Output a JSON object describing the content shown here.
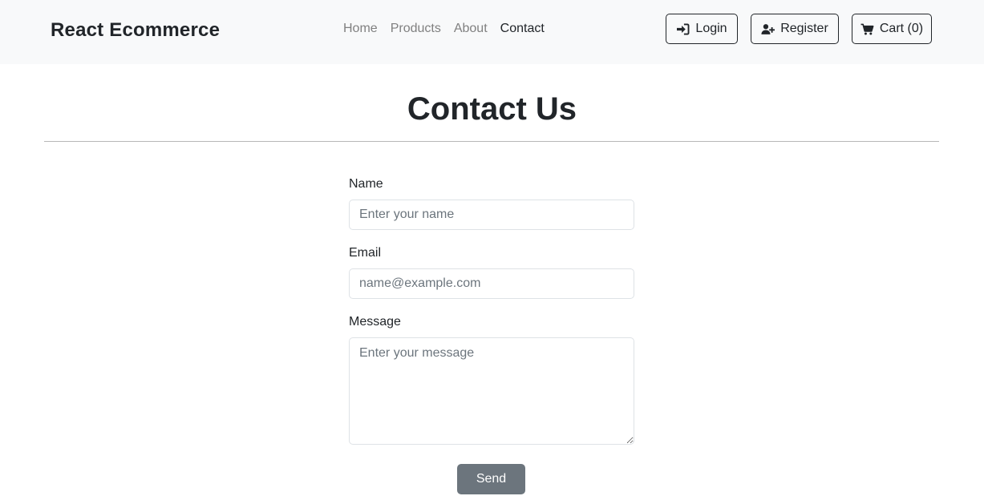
{
  "navbar": {
    "brand": "React Ecommerce",
    "links": [
      {
        "label": "Home"
      },
      {
        "label": "Products"
      },
      {
        "label": "About"
      },
      {
        "label": "Contact"
      }
    ],
    "login_label": "Login",
    "register_label": "Register",
    "cart_label": "Cart (0)",
    "login_icon": "sign-in-icon",
    "register_icon": "user-plus-icon",
    "cart_icon": "shopping-cart-icon"
  },
  "main": {
    "title": "Contact Us",
    "form": {
      "name_label": "Name",
      "name_placeholder": "Enter your name",
      "email_label": "Email",
      "email_placeholder": "name@example.com",
      "message_label": "Message",
      "message_placeholder": "Enter your message",
      "send_label": "Send"
    }
  },
  "colors": {
    "navbar_bg": "#f8f9fa",
    "text": "#212529",
    "muted_link": "#808080",
    "send_button": "#6c757d"
  }
}
